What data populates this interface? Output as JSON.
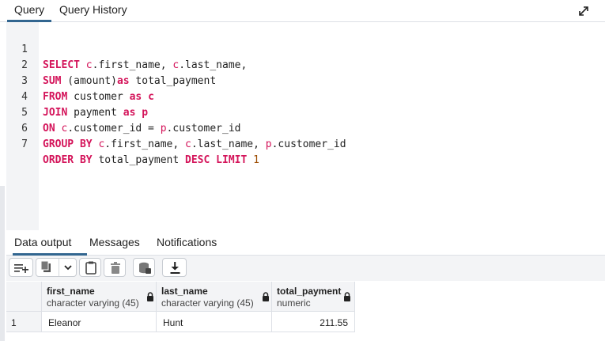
{
  "tabs": {
    "query": "Query",
    "history": "Query History"
  },
  "editor": {
    "lines": [
      "1",
      "2",
      "3",
      "4",
      "5",
      "6",
      "7"
    ]
  },
  "sql": {
    "l1": {
      "kw": "SELECT",
      "a1": "c",
      "c1": ".first_name, ",
      "a2": "c",
      "c2": ".last_name,"
    },
    "l2": {
      "kw": "SUM",
      "c1": " (amount)",
      "kw2": "as",
      "c2": " total_payment"
    },
    "l3": {
      "kw": "FROM",
      "c1": " customer ",
      "kw2": "as",
      "a1": " c"
    },
    "l4": {
      "kw": "JOIN",
      "c1": " payment ",
      "kw2": "as",
      "a1": " p"
    },
    "l5": {
      "kw": "ON",
      "a1": " c",
      "c1": ".customer_id = ",
      "a2": "p",
      "c2": ".customer_id"
    },
    "l6": {
      "kw": "GROUP BY",
      "a1": " c",
      "c1": ".first_name, ",
      "a2": "c",
      "c2": ".last_name, ",
      "a3": "p",
      "c3": ".customer_id"
    },
    "l7": {
      "kw": "ORDER BY",
      "c1": " total_payment ",
      "kw2": "DESC LIMIT",
      "n1": " 1"
    }
  },
  "result_tabs": {
    "data": "Data output",
    "messages": "Messages",
    "notifications": "Notifications"
  },
  "columns": [
    {
      "name": "first_name",
      "type": "character varying (45)"
    },
    {
      "name": "last_name",
      "type": "character varying (45)"
    },
    {
      "name": "total_payment",
      "type": "numeric"
    }
  ],
  "rows": [
    {
      "num": "1",
      "first_name": "Eleanor",
      "last_name": "Hunt",
      "total_payment": "211.55"
    }
  ],
  "icons": {
    "expand": "expand-icon",
    "add_row": "add-row-icon",
    "copy": "copy-icon",
    "dropdown": "chevron-down-icon",
    "paste": "paste-icon",
    "delete": "trash-icon",
    "save_data": "save-data-icon",
    "download": "download-icon",
    "lock": "lock-icon"
  },
  "colors": {
    "keyword": "#d4145a",
    "number": "#9c4b00",
    "accent": "#326690"
  }
}
